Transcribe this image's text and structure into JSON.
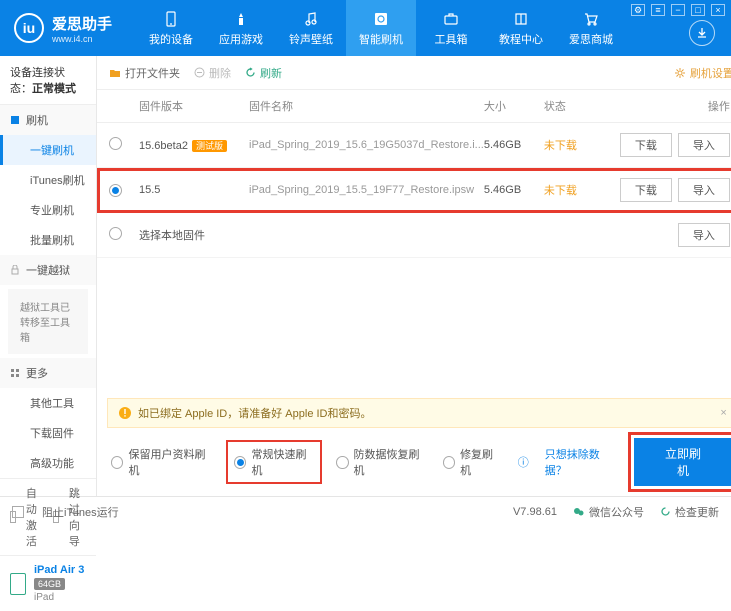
{
  "header": {
    "logo_letter": "iu",
    "logo_cn": "爱思助手",
    "logo_url": "www.i4.cn",
    "nav": [
      "我的设备",
      "应用游戏",
      "铃声壁纸",
      "智能刷机",
      "工具箱",
      "教程中心",
      "爱思商城"
    ]
  },
  "sidebar": {
    "conn_label": "设备连接状态：",
    "conn_value": "正常模式",
    "sec_flash": "刷机",
    "flash_items": [
      "一键刷机",
      "iTunes刷机",
      "专业刷机",
      "批量刷机"
    ],
    "sec_jail": "一键越狱",
    "jail_note": "越狱工具已转移至工具箱",
    "sec_more": "更多",
    "more_items": [
      "其他工具",
      "下载固件",
      "高级功能"
    ],
    "auto_activate": "自动激活",
    "skip_guide": "跳过向导",
    "device_name": "iPad Air 3",
    "device_cap": "64GB",
    "device_type": "iPad"
  },
  "toolbar": {
    "open": "打开文件夹",
    "delete": "删除",
    "refresh": "刷新",
    "settings": "刷机设置"
  },
  "table": {
    "hdr_version": "固件版本",
    "hdr_filename": "固件名称",
    "hdr_size": "大小",
    "hdr_state": "状态",
    "hdr_ops": "操作",
    "rows": [
      {
        "version": "15.6beta2",
        "tag": "测试版",
        "file": "iPad_Spring_2019_15.6_19G5037d_Restore.i...",
        "size": "5.46GB",
        "state": "未下载"
      },
      {
        "version": "15.5",
        "tag": "",
        "file": "iPad_Spring_2019_15.5_19F77_Restore.ipsw",
        "size": "5.46GB",
        "state": "未下载"
      }
    ],
    "select_local": "选择本地固件",
    "btn_download": "下载",
    "btn_import": "导入"
  },
  "alert": {
    "text": "如已绑定 Apple ID，请准备好 Apple ID和密码。"
  },
  "options": {
    "o1": "保留用户资料刷机",
    "o2": "常规快速刷机",
    "o3": "防数据恢复刷机",
    "o4": "修复刷机",
    "help": "只想抹除数据？",
    "primary": "立即刷机"
  },
  "statusbar": {
    "block_itunes": "阻止iTunes运行",
    "version": "V7.98.61",
    "wechat": "微信公众号",
    "check_update": "检查更新"
  }
}
